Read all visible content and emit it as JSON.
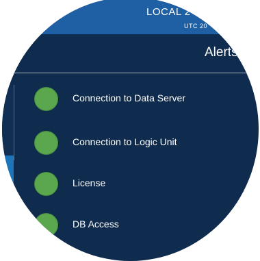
{
  "topbar": {
    "local_label": "LOCAL  2",
    "utc_label": "UTC  20"
  },
  "header": {
    "title": "Alerts"
  },
  "alerts": [
    {
      "label": "Connection to Data Server",
      "status": "ok",
      "status_color": "#5aa74d"
    },
    {
      "label": "Connection to Logic Unit",
      "status": "ok",
      "status_color": "#5aa74d"
    },
    {
      "label": "License",
      "status": "ok",
      "status_color": "#5aa74d"
    },
    {
      "label": "DB Access",
      "status": "ok",
      "status_color": "#5aa74d"
    }
  ],
  "colors": {
    "panel_bg": "#0f2b4d",
    "topbar_bg": "#1f5fa3",
    "ok_green": "#5aa74d"
  }
}
